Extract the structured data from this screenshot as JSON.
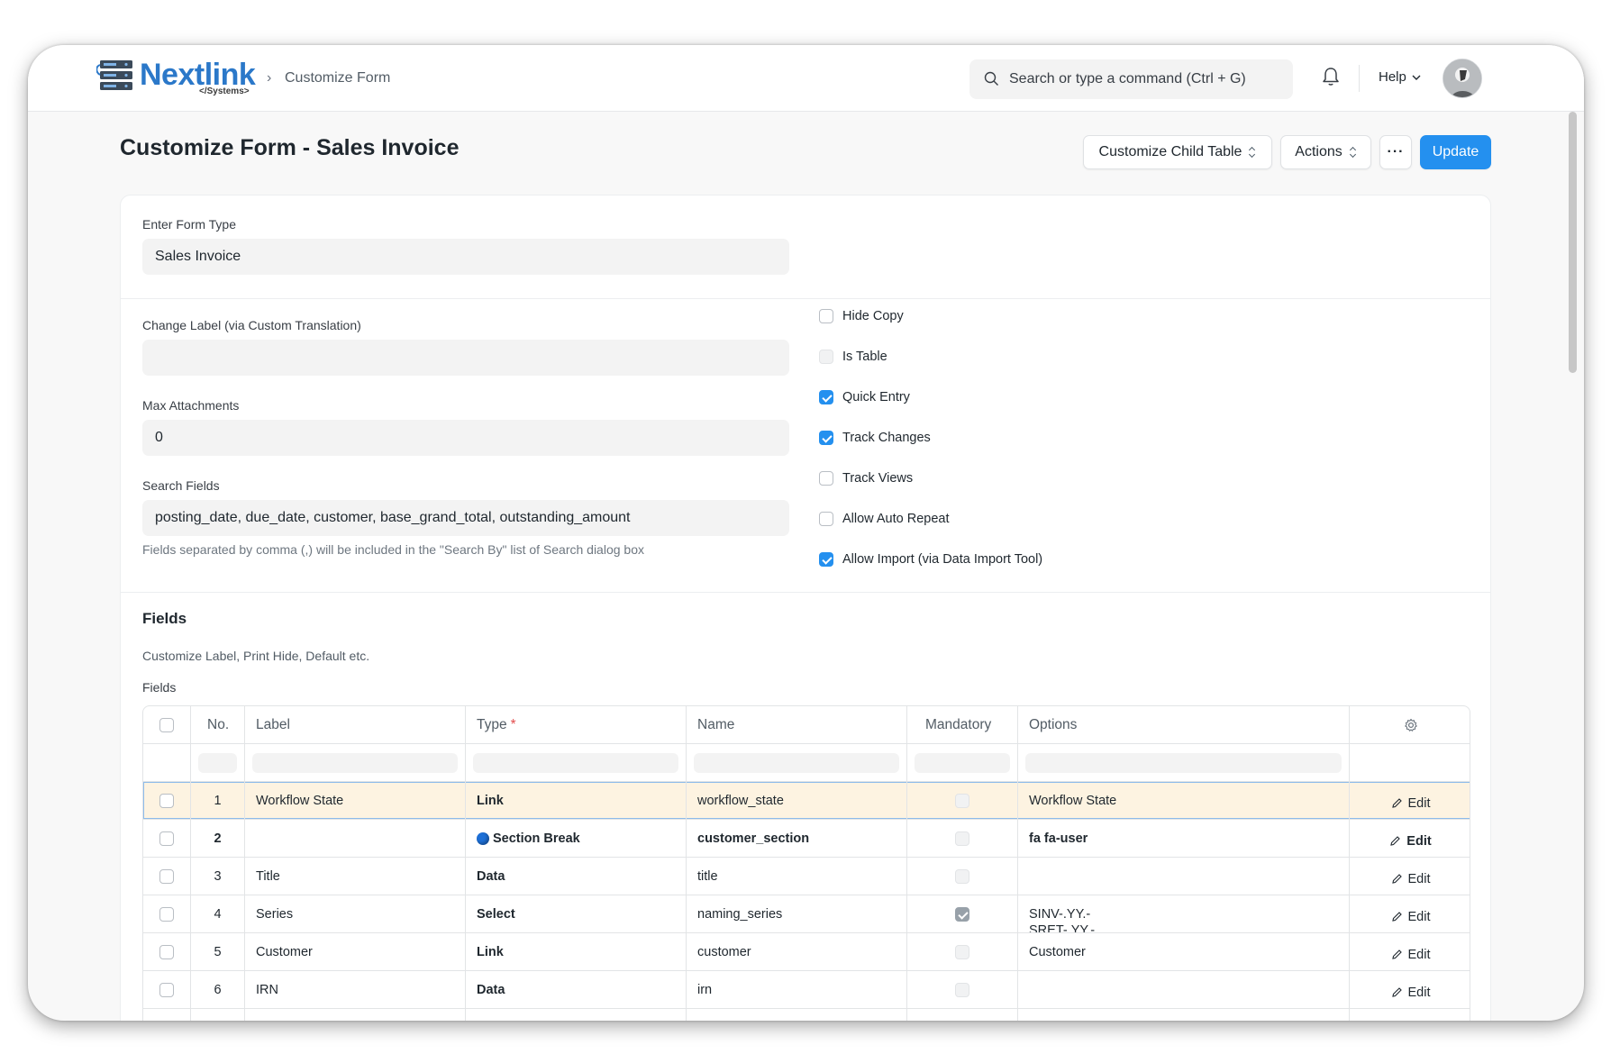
{
  "app": {
    "brand": "Nextlink",
    "brand_sub": "</Systems>",
    "breadcrumb": "Customize Form"
  },
  "navbar": {
    "search_placeholder": "Search or type a command (Ctrl + G)",
    "help_label": "Help"
  },
  "page": {
    "title": "Customize Form - Sales Invoice",
    "buttons": {
      "customize_child_table": "Customize Child Table",
      "actions": "Actions",
      "more": "···",
      "update": "Update"
    }
  },
  "form": {
    "form_type_label": "Enter Form Type",
    "form_type_value": "Sales Invoice",
    "change_label_label": "Change Label (via Custom Translation)",
    "change_label_value": "",
    "max_attachments_label": "Max Attachments",
    "max_attachments_value": "0",
    "search_fields_label": "Search Fields",
    "search_fields_value": "posting_date, due_date, customer, base_grand_total, outstanding_amount",
    "search_fields_help": "Fields separated by comma (,) will be included in the \"Search By\" list of Search dialog box",
    "checkboxes": [
      {
        "label": "Hide Copy",
        "checked": false,
        "disabled": false
      },
      {
        "label": "Is Table",
        "checked": false,
        "disabled": true
      },
      {
        "label": "Quick Entry",
        "checked": true,
        "disabled": false
      },
      {
        "label": "Track Changes",
        "checked": true,
        "disabled": false
      },
      {
        "label": "Track Views",
        "checked": false,
        "disabled": false
      },
      {
        "label": "Allow Auto Repeat",
        "checked": false,
        "disabled": false
      },
      {
        "label": "Allow Import (via Data Import Tool)",
        "checked": true,
        "disabled": false
      }
    ]
  },
  "fields_section": {
    "title": "Fields",
    "description": "Customize Label, Print Hide, Default etc.",
    "grid_label": "Fields",
    "columns": {
      "no": "No.",
      "label": "Label",
      "type": "Type",
      "type_required_mark": "*",
      "name": "Name",
      "mandatory": "Mandatory",
      "options": "Options"
    },
    "edit_label": "Edit",
    "rows": [
      {
        "no": "1",
        "label": "Workflow State",
        "type": "Link",
        "name": "workflow_state",
        "mandatory": false,
        "options": "Workflow State"
      },
      {
        "no": "2",
        "label": "",
        "type": "Section Break",
        "name": "customer_section",
        "mandatory": false,
        "options": "fa fa-user"
      },
      {
        "no": "3",
        "label": "Title",
        "type": "Data",
        "name": "title",
        "mandatory": false,
        "options": ""
      },
      {
        "no": "4",
        "label": "Series",
        "type": "Select",
        "name": "naming_series",
        "mandatory": true,
        "options": "SINV-.YY.-\nSRET-.YY.-"
      },
      {
        "no": "5",
        "label": "Customer",
        "type": "Link",
        "name": "customer",
        "mandatory": false,
        "options": "Customer"
      },
      {
        "no": "6",
        "label": "IRN",
        "type": "Data",
        "name": "irn",
        "mandatory": false,
        "options": ""
      }
    ]
  },
  "colors": {
    "primary": "#2490ef",
    "brand": "#2b78c9",
    "active_row": "#fdf3e1"
  }
}
